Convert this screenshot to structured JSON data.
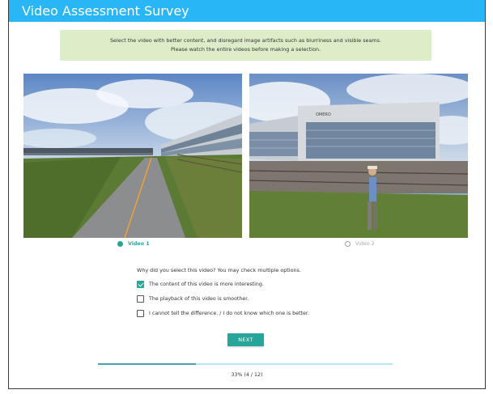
{
  "header": {
    "title": "Video Assessment Survey"
  },
  "instructions": {
    "line1": "Select the video with better content, and disregard image artifacts such as blurriness and visible seams.",
    "line2": "Please watch the entire videos before making a selection."
  },
  "videos": [
    {
      "label": "Video 1",
      "selected": true
    },
    {
      "label": "Video 2",
      "selected": false,
      "sign_text": "OMERO"
    }
  ],
  "question": "Why did you select this video? You may check multiple options.",
  "options": [
    {
      "label": "The content of this video is more interesting.",
      "checked": true
    },
    {
      "label": "The playback of this video is smoother.",
      "checked": false
    },
    {
      "label": "I cannot tell the difference. / I do not know which one is better.",
      "checked": false
    }
  ],
  "next_label": "NEXT",
  "progress": {
    "label": "33% (4 / 12)",
    "fraction": 0.333
  },
  "colors": {
    "header": "#29b6f6",
    "accent": "#26a69a",
    "instructions_bg": "#dcedc8"
  }
}
